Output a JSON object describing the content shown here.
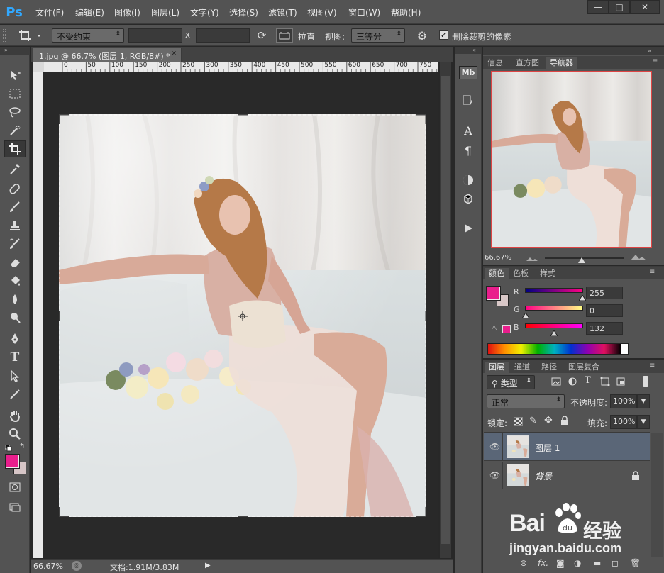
{
  "app": {
    "logo": "Ps"
  },
  "menu": [
    "文件(F)",
    "编辑(E)",
    "图像(I)",
    "图层(L)",
    "文字(Y)",
    "选择(S)",
    "滤镜(T)",
    "视图(V)",
    "窗口(W)",
    "帮助(H)"
  ],
  "window_controls": {
    "minimize": "—",
    "maximize": "□",
    "close": "✕"
  },
  "options_bar": {
    "ratio_select": "不受约束",
    "width_value": "",
    "times": "x",
    "height_value": "",
    "straighten": "拉直",
    "view_label": "视图:",
    "view_select": "三等分",
    "delete_cropped_label": "删除裁剪的像素",
    "delete_cropped_checked": true
  },
  "document": {
    "tab_title": "1.jpg @ 66.7% (图层 1, RGB/8#) *",
    "tab_close": "✕",
    "ruler_ticks": [
      "0",
      "50",
      "100",
      "150",
      "200",
      "250",
      "300",
      "350",
      "400",
      "450",
      "500",
      "550",
      "600",
      "650",
      "700",
      "750",
      "8"
    ],
    "zoom": "66.67%",
    "doc_info": "文档:1.91M/3.83M"
  },
  "icon_strip": [
    "mini-bridge-icon",
    "history-icon",
    "character-icon",
    "paragraph-icon",
    "adjustments-icon",
    "3d-icon",
    "actions-icon"
  ],
  "strip_labels": {
    "mb": "Mb",
    "char": "A",
    "para": "¶"
  },
  "navigator": {
    "tabs": [
      "信息",
      "直方图",
      "导航器"
    ],
    "active_tab": "导航器",
    "zoom": "66.67%"
  },
  "color_panel": {
    "tabs": [
      "颜色",
      "色板",
      "样式"
    ],
    "active_tab": "颜色",
    "foreground": "#e91e8c",
    "background": "#d9c8c8",
    "r_label": "R",
    "r_value": "255",
    "g_label": "G",
    "g_value": "0",
    "b_label": "B",
    "b_value": "132",
    "warning_symbol": "!"
  },
  "layers_panel": {
    "tabs": [
      "图层",
      "通道",
      "路径",
      "图层复合"
    ],
    "active_tab": "图层",
    "filter_kind": "类型",
    "blend_mode": "正常",
    "opacity_label": "不透明度:",
    "opacity": "100%",
    "lock_label": "锁定:",
    "fill_label": "填充:",
    "fill": "100%",
    "filter_icons": [
      "T",
      "fx"
    ],
    "layers": [
      {
        "name": "图层 1",
        "selected": true,
        "locked": false
      },
      {
        "name": "背景",
        "selected": false,
        "locked": true
      }
    ],
    "footer_link": "⊝",
    "footer_fx": "fx."
  },
  "watermark": {
    "brand": "Bai",
    "brand_suffix": "经验",
    "url": "jingyan.baidu.com"
  },
  "colors": {
    "accent": "#e91e8c",
    "panel_bg": "#535353",
    "dark_bg": "#282828",
    "selected_layer": "#5a6677"
  }
}
